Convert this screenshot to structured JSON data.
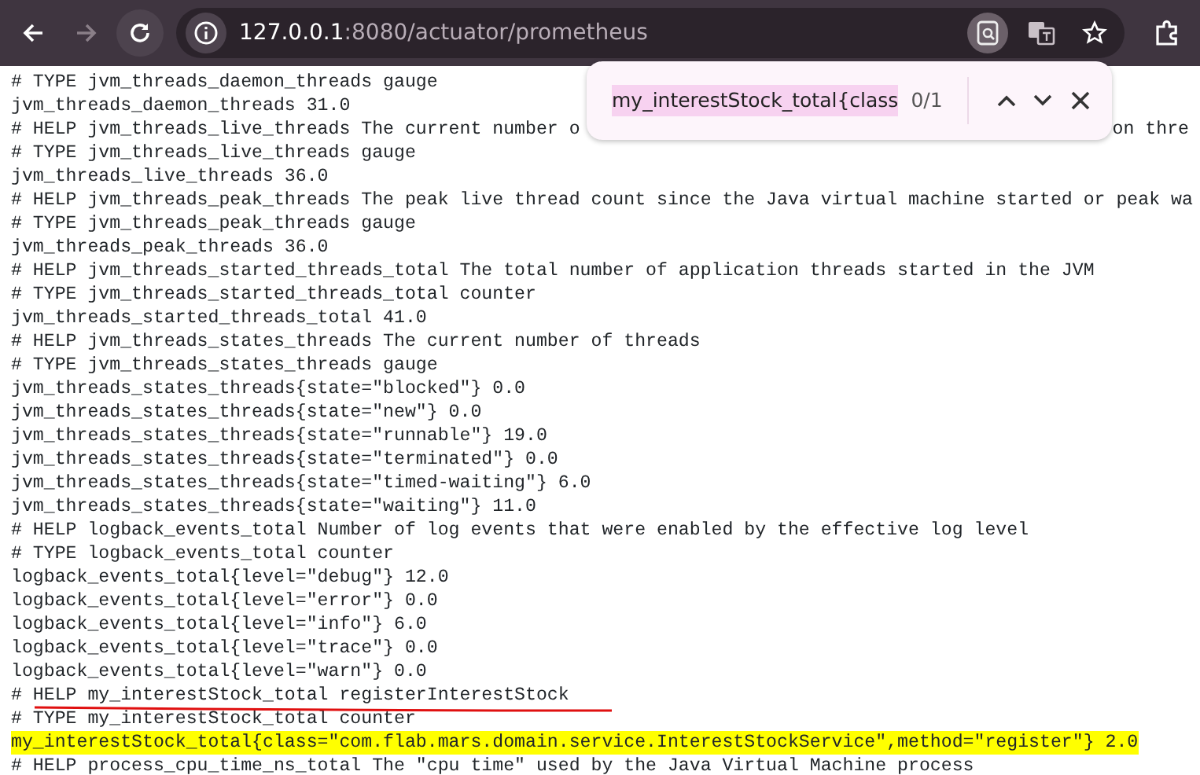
{
  "toolbar": {
    "back": {
      "disabled": false
    },
    "forward": {
      "disabled": true
    },
    "url_host": "127.0.0.1",
    "url_rest": ":8080/actuator/prometheus"
  },
  "find_bar": {
    "query": "my_interestStock_total{class",
    "count": "0/1"
  },
  "lines": [
    {
      "text": "# TYPE jvm_threads_daemon_threads gauge",
      "highlighted": false,
      "underlined": false
    },
    {
      "text": "jvm_threads_daemon_threads 31.0",
      "highlighted": false,
      "underlined": false
    },
    {
      "text": "# HELP jvm_threads_live_threads The current number o",
      "tail": "on thre",
      "highlighted": false,
      "underlined": false
    },
    {
      "text": "# TYPE jvm_threads_live_threads gauge",
      "highlighted": false,
      "underlined": false
    },
    {
      "text": "jvm_threads_live_threads 36.0",
      "highlighted": false,
      "underlined": false
    },
    {
      "text": "# HELP jvm_threads_peak_threads The peak live thread count since the Java virtual machine started or peak wa",
      "highlighted": false,
      "underlined": false
    },
    {
      "text": "# TYPE jvm_threads_peak_threads gauge",
      "highlighted": false,
      "underlined": false
    },
    {
      "text": "jvm_threads_peak_threads 36.0",
      "highlighted": false,
      "underlined": false
    },
    {
      "text": "# HELP jvm_threads_started_threads_total The total number of application threads started in the JVM",
      "highlighted": false,
      "underlined": false
    },
    {
      "text": "# TYPE jvm_threads_started_threads_total counter",
      "highlighted": false,
      "underlined": false
    },
    {
      "text": "jvm_threads_started_threads_total 41.0",
      "highlighted": false,
      "underlined": false
    },
    {
      "text": "# HELP jvm_threads_states_threads The current number of threads",
      "highlighted": false,
      "underlined": false
    },
    {
      "text": "# TYPE jvm_threads_states_threads gauge",
      "highlighted": false,
      "underlined": false
    },
    {
      "text": "jvm_threads_states_threads{state=\"blocked\"} 0.0",
      "highlighted": false,
      "underlined": false
    },
    {
      "text": "jvm_threads_states_threads{state=\"new\"} 0.0",
      "highlighted": false,
      "underlined": false
    },
    {
      "text": "jvm_threads_states_threads{state=\"runnable\"} 19.0",
      "highlighted": false,
      "underlined": false
    },
    {
      "text": "jvm_threads_states_threads{state=\"terminated\"} 0.0",
      "highlighted": false,
      "underlined": false
    },
    {
      "text": "jvm_threads_states_threads{state=\"timed-waiting\"} 6.0",
      "highlighted": false,
      "underlined": false
    },
    {
      "text": "jvm_threads_states_threads{state=\"waiting\"} 11.0",
      "highlighted": false,
      "underlined": false
    },
    {
      "text": "# HELP logback_events_total Number of log events that were enabled by the effective log level",
      "highlighted": false,
      "underlined": false
    },
    {
      "text": "# TYPE logback_events_total counter",
      "highlighted": false,
      "underlined": false
    },
    {
      "text": "logback_events_total{level=\"debug\"} 12.0",
      "highlighted": false,
      "underlined": false
    },
    {
      "text": "logback_events_total{level=\"error\"} 0.0",
      "highlighted": false,
      "underlined": false
    },
    {
      "text": "logback_events_total{level=\"info\"} 6.0",
      "highlighted": false,
      "underlined": false
    },
    {
      "text": "logback_events_total{level=\"trace\"} 0.0",
      "highlighted": false,
      "underlined": false
    },
    {
      "text": "logback_events_total{level=\"warn\"} 0.0",
      "highlighted": false,
      "underlined": false
    },
    {
      "text": "# HELP my_interestStock_total registerInterestStock",
      "highlighted": false,
      "underlined": true
    },
    {
      "text": "# TYPE my_interestStock_total counter",
      "highlighted": false,
      "underlined": false
    },
    {
      "text": "my_interestStock_total{class=\"com.flab.mars.domain.service.InterestStockService\",method=\"register\"} 2.0",
      "highlighted": true,
      "underlined": false
    },
    {
      "text": "# HELP process_cpu_time_ns_total The \"cpu time\" used by the Java Virtual Machine process",
      "highlighted": false,
      "underlined": false
    }
  ]
}
